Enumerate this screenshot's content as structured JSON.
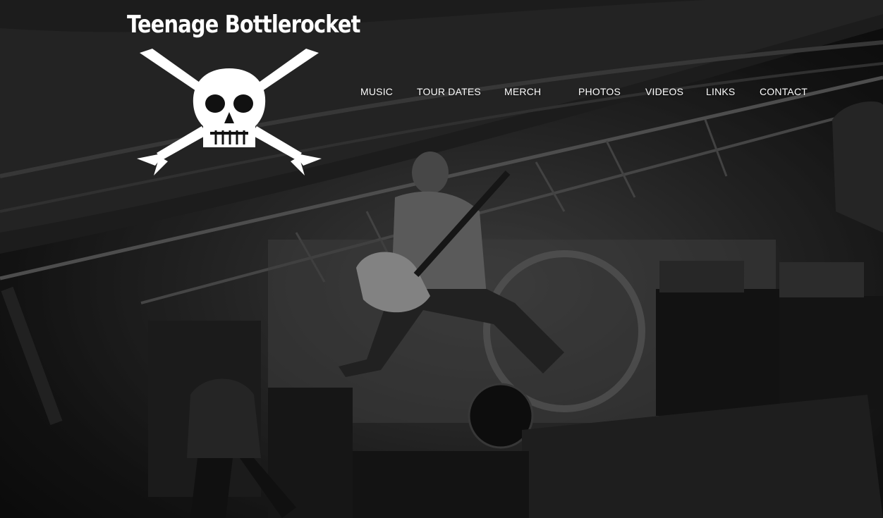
{
  "brand": {
    "logo_text": "Teenage Bottlerocket",
    "logo_icon": "skull-crossbones-icon"
  },
  "nav": {
    "items": [
      {
        "label": "MUSIC"
      },
      {
        "label": "TOUR DATES"
      },
      {
        "label": "MERCH"
      },
      {
        "label": "PHOTOS"
      },
      {
        "label": "VIDEOS"
      },
      {
        "label": "LINKS"
      },
      {
        "label": "CONTACT"
      }
    ]
  },
  "hero": {
    "image": "black-and-white concert photo"
  },
  "colors": {
    "text": "#ffffff",
    "background": "#1a1a1a"
  }
}
